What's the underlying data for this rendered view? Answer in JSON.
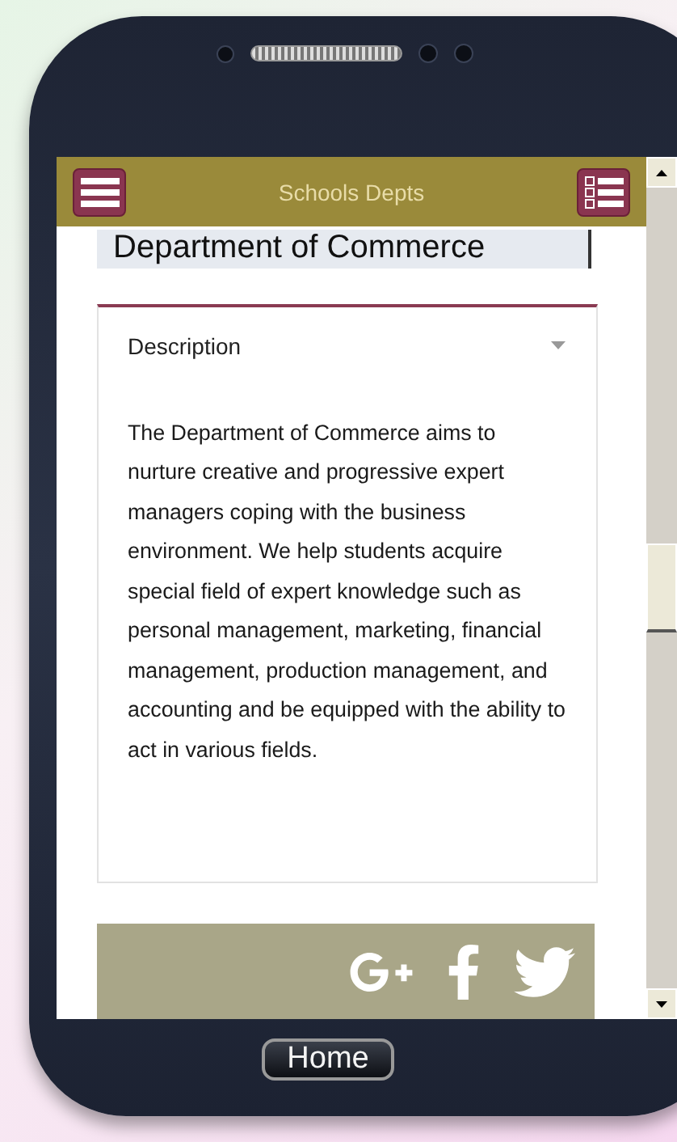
{
  "header": {
    "title": "Schools Depts"
  },
  "department": {
    "value": "Department of Commerce"
  },
  "section": {
    "title": "Description",
    "body": "The Department of Commerce aims to nurture creative and progressive expert managers coping with the business environment. We help students acquire special field of expert knowledge such as personal management, marketing, financial management, production management, and accounting and be equipped with the ability to act in various fields."
  },
  "home_button": {
    "label": "Home"
  }
}
